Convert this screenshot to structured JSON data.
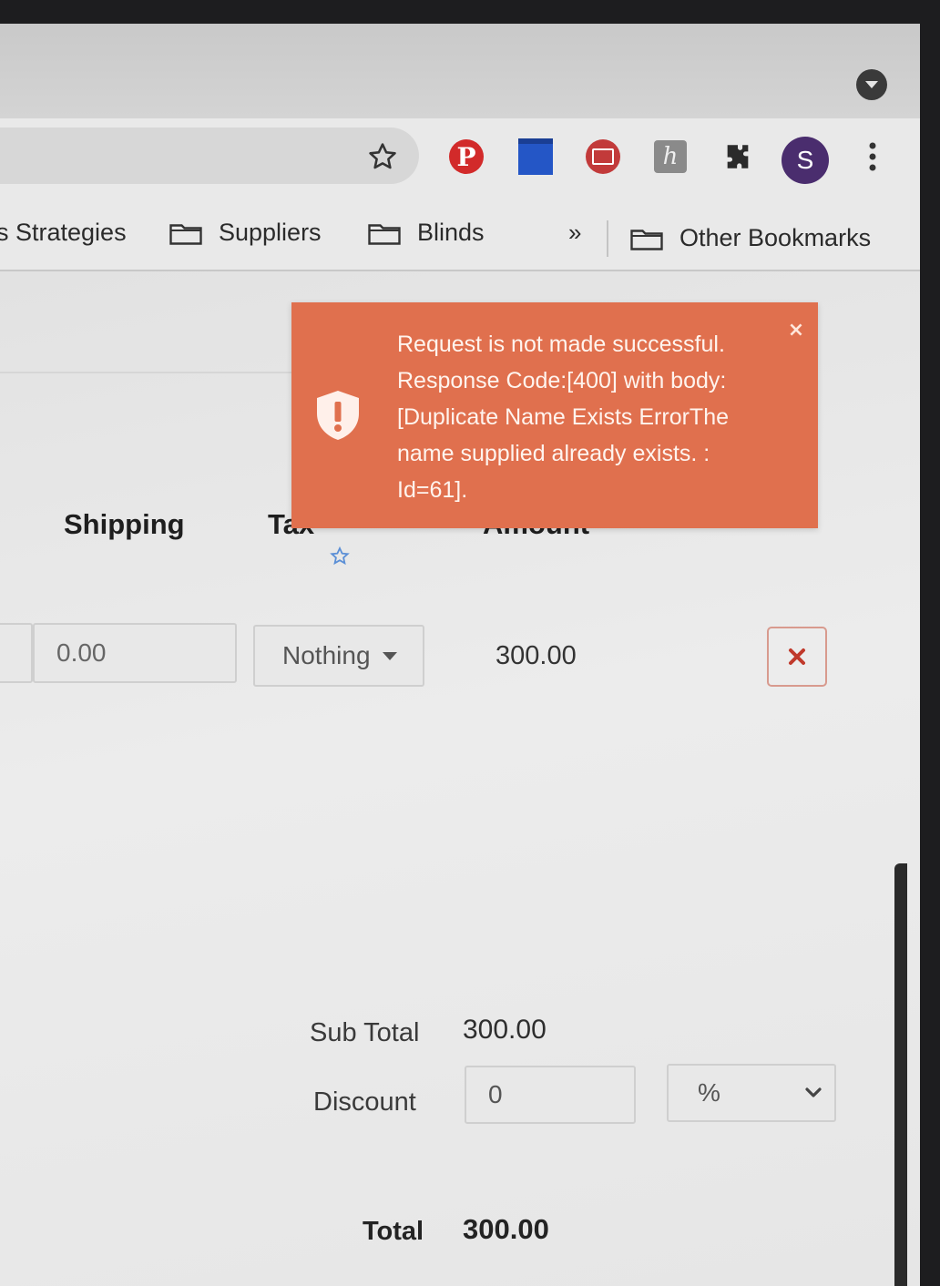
{
  "browser": {
    "profile_initial": "S",
    "icons": [
      "star-icon",
      "pinterest-icon",
      "calendar-icon",
      "screencast-icon",
      "h-icon",
      "puzzle-icon",
      "menu-icon"
    ],
    "pinterest_glyph": "P",
    "h_glyph": "h",
    "bookmarks": [
      {
        "label": "s Strategies"
      },
      {
        "label": "Suppliers"
      },
      {
        "label": "Blinds"
      }
    ],
    "overflow_label": "»",
    "other_bookmarks_label": "Other Bookmarks"
  },
  "table": {
    "headers": {
      "shipping": "Shipping",
      "tax": "Tax",
      "amount": "Amount"
    },
    "row": {
      "shipping": "0.00",
      "tax": "Nothing",
      "amount": "300.00"
    }
  },
  "summary": {
    "subtotal_label": "Sub Total",
    "subtotal_value": "300.00",
    "discount_label": "Discount",
    "discount_value": "0",
    "discount_type": "%",
    "total_label": "Total",
    "total_value": "300.00"
  },
  "toast": {
    "message": "Request is not made successful. Response Code:[400] with body: [Duplicate Name Exists ErrorThe name supplied already exists. : Id=61].",
    "close_label": "×"
  },
  "colors": {
    "toast_bg": "#e0704e",
    "avatar_bg": "#4a2d6e",
    "remove_accent": "#c0392b"
  }
}
